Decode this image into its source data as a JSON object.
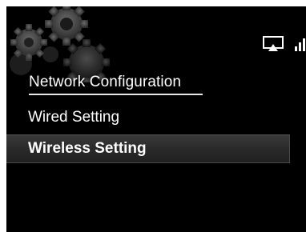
{
  "header": {
    "icons": [
      "gear-icon",
      "airplay-icon",
      "signal-icon"
    ]
  },
  "menu": {
    "title": "Network Configuration",
    "items": [
      {
        "label": "Wired Setting",
        "selected": false
      },
      {
        "label": "Wireless Setting",
        "selected": true
      }
    ]
  },
  "colors": {
    "background": "#000000",
    "text": "#ffffff",
    "highlight": "#2e2e2e"
  }
}
